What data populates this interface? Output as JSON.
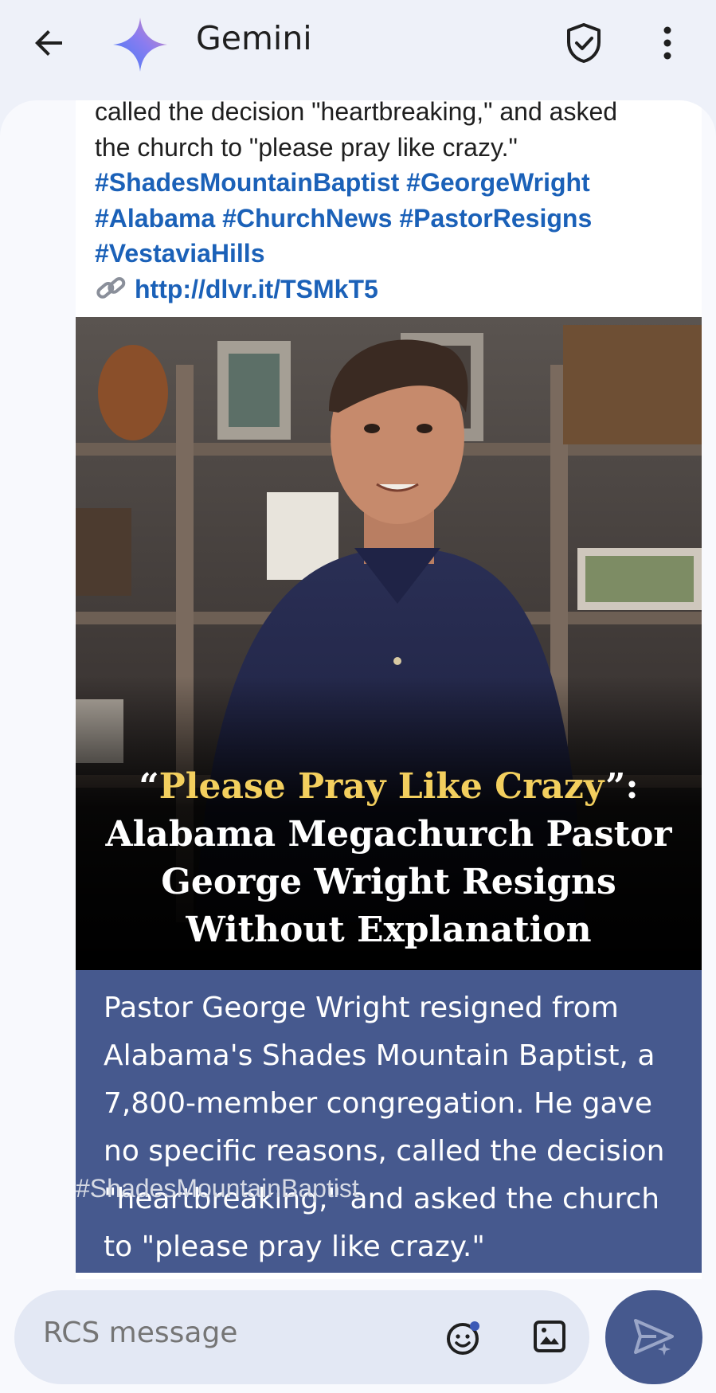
{
  "header": {
    "back_icon": "arrow-back-icon",
    "app_icon": "gemini-sparkle-icon",
    "title": "Gemini",
    "verified_icon": "shield-check-icon",
    "more_icon": "more-vert-icon"
  },
  "message": {
    "text_line1": "called the decision \"heartbreaking,\" and asked",
    "text_line2": "the church to \"please pray like crazy.\"",
    "hashtags": [
      "#ShadesMountainBaptist",
      "#GeorgeWright",
      "#Alabama",
      "#ChurchNews",
      "#PastorResigns",
      "#VestaviaHills"
    ],
    "link_icon": "link-icon",
    "link": "http://dlvr.it/TSMkT5",
    "thumbnail": {
      "quote_open": "“",
      "headline_quote": "Please Pray Like Crazy",
      "quote_close": "”:",
      "headline_line2": "Alabama Megachurch Pastor",
      "headline_line3": "George Wright Resigns",
      "headline_line4": "Without Explanation"
    },
    "summary": "Pastor George Wright resigned from Alabama's Shades Mountain Baptist, a 7,800-member congregation. He gave no specific reasons, called the decision \"heartbreaking,\" and asked the church to \"please pray like crazy.\"",
    "overflow_text": "#ShadesMountainBaptist"
  },
  "composer": {
    "placeholder": "RCS message",
    "emoji_icon": "emoji-icon",
    "attach_icon": "image-icon",
    "send_icon": "send-icon"
  },
  "colors": {
    "accent": "#46598e",
    "link": "#1b61b8",
    "headline_gold": "#f3cf5e"
  }
}
